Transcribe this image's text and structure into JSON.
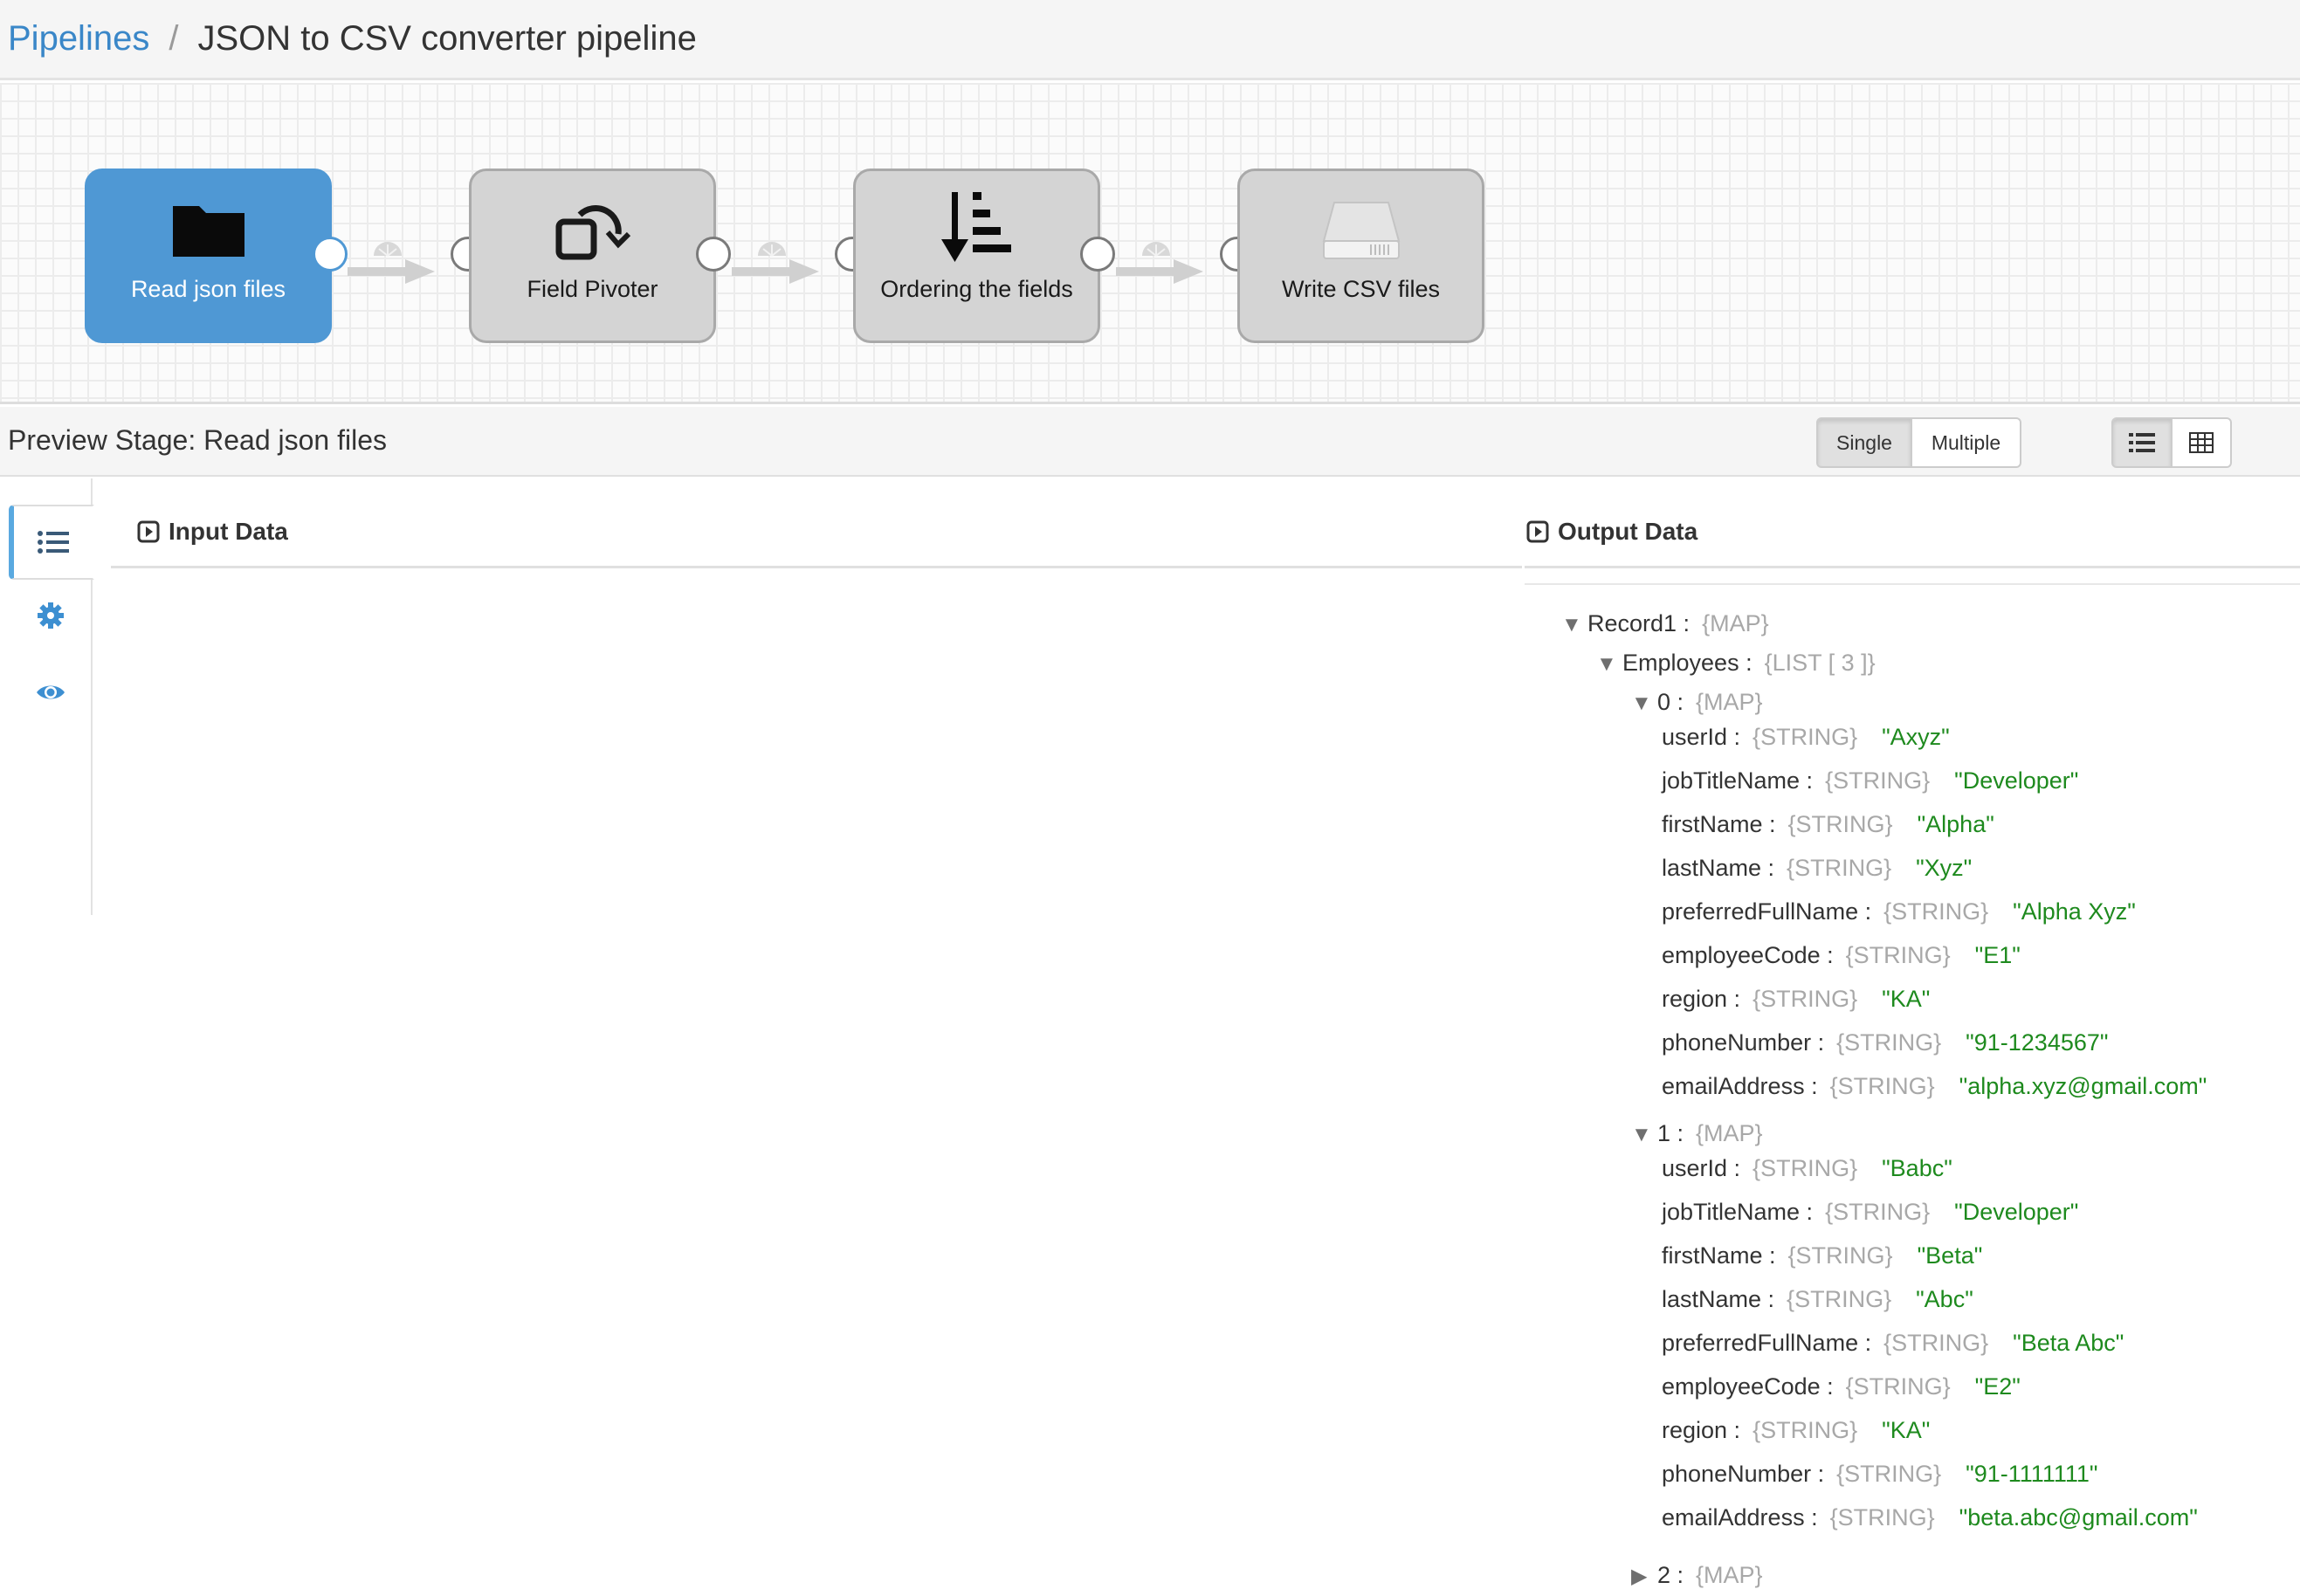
{
  "breadcrumb": {
    "root": "Pipelines",
    "separator": "/",
    "current": "JSON to CSV converter pipeline"
  },
  "pipeline": {
    "stages": [
      {
        "label": "Read json files",
        "icon": "folder-icon",
        "selected": true
      },
      {
        "label": "Field Pivoter",
        "icon": "pivot-rotate-icon",
        "selected": false
      },
      {
        "label": "Ordering the fields",
        "icon": "sort-order-icon",
        "selected": false
      },
      {
        "label": "Write CSV files",
        "icon": "hard-drive-icon",
        "selected": false
      }
    ],
    "accent_color": "#4f98d4"
  },
  "preview": {
    "title": "Preview Stage: Read json files",
    "batch_mode": {
      "single_label": "Single",
      "multiple_label": "Multiple",
      "active": "Single"
    },
    "view_mode": {
      "list_icon": "list-view-icon",
      "table_icon": "table-view-icon",
      "active": "list"
    },
    "side_tabs": [
      "list-icon",
      "gear-icon",
      "eye-icon"
    ],
    "input_title": "Input Data",
    "output_title": "Output Data"
  },
  "output_tree": {
    "record": {
      "key": "Record1 :",
      "type": "{MAP}"
    },
    "employees": {
      "key": "Employees :",
      "type": "{LIST [ 3 ]}"
    },
    "items": [
      {
        "key": "0 :",
        "type": "{MAP}",
        "fields": [
          {
            "key": "userId :",
            "type": "{STRING}",
            "value": "\"Axyz\""
          },
          {
            "key": "jobTitleName :",
            "type": "{STRING}",
            "value": "\"Developer\""
          },
          {
            "key": "firstName :",
            "type": "{STRING}",
            "value": "\"Alpha\""
          },
          {
            "key": "lastName :",
            "type": "{STRING}",
            "value": "\"Xyz\""
          },
          {
            "key": "preferredFullName :",
            "type": "{STRING}",
            "value": "\"Alpha Xyz\""
          },
          {
            "key": "employeeCode :",
            "type": "{STRING}",
            "value": "\"E1\""
          },
          {
            "key": "region :",
            "type": "{STRING}",
            "value": "\"KA\""
          },
          {
            "key": "phoneNumber :",
            "type": "{STRING}",
            "value": "\"91-1234567\""
          },
          {
            "key": "emailAddress :",
            "type": "{STRING}",
            "value": "\"alpha.xyz@gmail.com\""
          }
        ]
      },
      {
        "key": "1 :",
        "type": "{MAP}",
        "fields": [
          {
            "key": "userId :",
            "type": "{STRING}",
            "value": "\"Babc\""
          },
          {
            "key": "jobTitleName :",
            "type": "{STRING}",
            "value": "\"Developer\""
          },
          {
            "key": "firstName :",
            "type": "{STRING}",
            "value": "\"Beta\""
          },
          {
            "key": "lastName :",
            "type": "{STRING}",
            "value": "\"Abc\""
          },
          {
            "key": "preferredFullName :",
            "type": "{STRING}",
            "value": "\"Beta Abc\""
          },
          {
            "key": "employeeCode :",
            "type": "{STRING}",
            "value": "\"E2\""
          },
          {
            "key": "region :",
            "type": "{STRING}",
            "value": "\"KA\""
          },
          {
            "key": "phoneNumber :",
            "type": "{STRING}",
            "value": "\"91-1111111\""
          },
          {
            "key": "emailAddress :",
            "type": "{STRING}",
            "value": "\"beta.abc@gmail.com\""
          }
        ]
      }
    ],
    "collapsed_item": {
      "key": "2 :",
      "type": "{MAP}"
    }
  }
}
